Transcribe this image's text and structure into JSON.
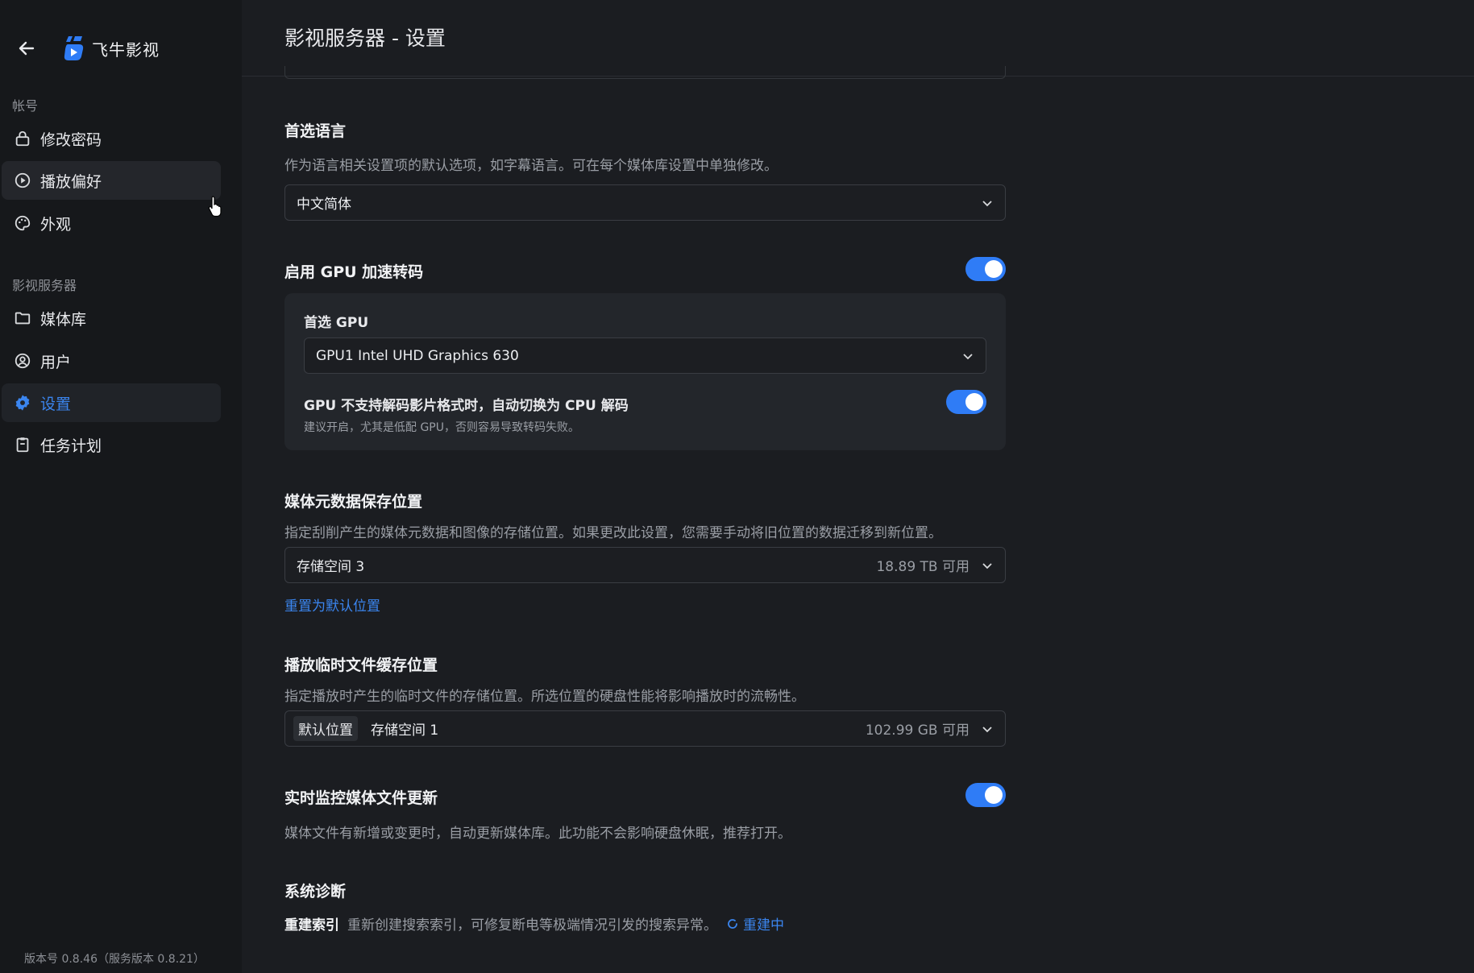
{
  "app": {
    "name": "飞牛影视",
    "brand_color": "#2f7cf6"
  },
  "sidebar": {
    "sections": [
      {
        "label": "帐号"
      },
      {
        "label": "影视服务器"
      }
    ],
    "items": [
      {
        "label": "修改密码",
        "icon": "lock-icon"
      },
      {
        "label": "播放偏好",
        "icon": "play-circle-icon"
      },
      {
        "label": "外观",
        "icon": "palette-icon"
      },
      {
        "label": "媒体库",
        "icon": "folder-icon"
      },
      {
        "label": "用户",
        "icon": "user-icon"
      },
      {
        "label": "设置",
        "icon": "gear-icon",
        "active": true
      },
      {
        "label": "任务计划",
        "icon": "clipboard-icon"
      }
    ],
    "version": "版本号 0.8.46（服务版本 0.8.21）"
  },
  "header": {
    "title": "影视服务器 - 设置"
  },
  "language": {
    "title": "首选语言",
    "desc": "作为语言相关设置项的默认选项，如字幕语言。可在每个媒体库设置中单独修改。",
    "value": "中文简体"
  },
  "gpu": {
    "title": "启用 GPU 加速转码",
    "enabled": true,
    "preferred_label": "首选 GPU",
    "preferred_value": "GPU1 Intel UHD Graphics 630",
    "fallback_title": "GPU 不支持解码影片格式时，自动切换为 CPU 解码",
    "fallback_desc": "建议开启，尤其是低配 GPU，否则容易导致转码失败。",
    "fallback_enabled": true
  },
  "metadata": {
    "title": "媒体元数据保存位置",
    "desc": "指定刮削产生的媒体元数据和图像的存储位置。如果更改此设置，您需要手动将旧位置的数据迁移到新位置。",
    "value": "存储空间 3",
    "free": "18.89 TB 可用",
    "reset_link": "重置为默认位置"
  },
  "cache": {
    "title": "播放临时文件缓存位置",
    "desc": "指定播放时产生的临时文件的存储位置。所选位置的硬盘性能将影响播放时的流畅性。",
    "tag": "默认位置",
    "value": "存储空间 1",
    "free": "102.99 GB 可用"
  },
  "monitor": {
    "title": "实时监控媒体文件更新",
    "desc": "媒体文件有新增或变更时，自动更新媒体库。此功能不会影响硬盘休眠，推荐打开。",
    "enabled": true
  },
  "diagnostics": {
    "title": "系统诊断",
    "rebuild_label": "重建索引",
    "rebuild_desc": "重新创建搜索索引，可修复断电等极端情况引发的搜索异常。",
    "rebuild_status": "重建中"
  }
}
